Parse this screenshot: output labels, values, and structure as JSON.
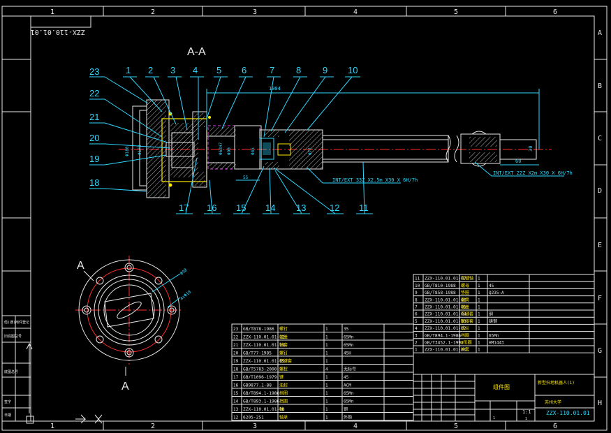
{
  "border": {
    "zones_top": [
      "1",
      "2",
      "3",
      "4",
      "5",
      "6"
    ],
    "zones_bottom": [
      "1",
      "2",
      "3",
      "4",
      "5",
      "6"
    ],
    "zones_right": [
      "A",
      "B",
      "C",
      "D",
      "E",
      "F",
      "G",
      "H"
    ]
  },
  "stamp": "ZZX-110.01.01",
  "section_title": "A-A",
  "view_label": "A",
  "balloons_top": [
    "23",
    "1",
    "2",
    "3",
    "4",
    "5",
    "6",
    "7",
    "8",
    "9",
    "10"
  ],
  "balloons_left": [
    "22",
    "21",
    "20",
    "19",
    "18"
  ],
  "balloons_bottom": [
    "17",
    "16",
    "15",
    "14",
    "13",
    "12",
    "11"
  ],
  "dims": {
    "overall": "1004",
    "d1": "60",
    "d2": "30",
    "d3": "55",
    "thread1": "INT/EXT 33Z X2.5m X30 X 6H/7h",
    "thread2": "INT/EXT 22Z X2m X30 X 6H/7h",
    "dia_a": "Φ180",
    "dia_b": "Φ172",
    "dia_c": "Φ77",
    "dia_d": "Φ45",
    "dia_e": "Φ62H7",
    "dia_f": "Φ90",
    "circle_dim": "Φ98",
    "hole_dim": "4xΦ18"
  },
  "left_strip": [
    "借(通)用件登记",
    "旧底图总号",
    "底图总号",
    "签字",
    "日期"
  ],
  "bom_right": [
    {
      "no": "11",
      "code": "ZZX-110.01.01-07",
      "name": "花键轴",
      "qty": "1",
      "mat": "",
      "note": ""
    },
    {
      "no": "10",
      "code": "GB/T810-1988",
      "name": "螺母",
      "qty": "1",
      "mat": "45",
      "note": ""
    },
    {
      "no": "9",
      "code": "GB/T858-1988",
      "name": "垫圈",
      "qty": "1",
      "mat": "Q235-A",
      "note": ""
    },
    {
      "no": "8",
      "code": "ZZX-110.01.01-06",
      "name": "套筒",
      "qty": "1",
      "mat": "",
      "note": ""
    },
    {
      "no": "7",
      "code": "ZZX-110.01.01-05",
      "name": "端盖",
      "qty": "1",
      "mat": "",
      "note": ""
    },
    {
      "no": "6",
      "code": "ZZX-110.01.01-04",
      "name": "花键套",
      "qty": "1",
      "mat": "钢",
      "note": ""
    },
    {
      "no": "5",
      "code": "ZZX-110.01.01-03",
      "name": "联接套",
      "qty": "1",
      "mat": "铸钢",
      "note": ""
    },
    {
      "no": "4",
      "code": "ZZX-110.01.01-02",
      "name": "法兰",
      "qty": "1",
      "mat": "",
      "note": ""
    },
    {
      "no": "3",
      "code": "GB/T894.1-1986",
      "name": "挡圈",
      "qty": "1",
      "mat": "65Mn",
      "note": ""
    },
    {
      "no": "2",
      "code": "GB/T3452.1-1992",
      "name": "O形圈",
      "qty": "1",
      "mat": "HM1443",
      "note": ""
    },
    {
      "no": "1",
      "code": "ZZX-110.01.01-01",
      "name": "外套",
      "qty": "1",
      "mat": "",
      "note": ""
    }
  ],
  "bom_left": [
    {
      "no": "23",
      "code": "GB/T878-1986",
      "name": "螺钉",
      "qty": "1",
      "mat": "35",
      "note": ""
    },
    {
      "no": "22",
      "code": "ZZX-110.01.01-12",
      "name": "端盖",
      "qty": "1",
      "mat": "65Mn",
      "note": ""
    },
    {
      "no": "21",
      "code": "ZZX-110.01.01-11",
      "name": "轴套",
      "qty": "1",
      "mat": "65Mn",
      "note": ""
    },
    {
      "no": "20",
      "code": "GB/T77-1985",
      "name": "螺钉",
      "qty": "1",
      "mat": "45H",
      "note": ""
    },
    {
      "no": "19",
      "code": "ZZX-110.01.01-09",
      "name": "花键套",
      "qty": "1",
      "mat": "",
      "note": ""
    },
    {
      "no": "18",
      "code": "GB/T5783-2000",
      "name": "螺栓",
      "qty": "4",
      "mat": "无标号",
      "note": ""
    },
    {
      "no": "17",
      "code": "GB/T1096-1979",
      "name": "键",
      "qty": "1",
      "mat": "45",
      "note": ""
    },
    {
      "no": "16",
      "code": "GB9877.1-88",
      "name": "油封",
      "qty": "1",
      "mat": "ACM",
      "note": ""
    },
    {
      "no": "15",
      "code": "GB/T894.1-1986",
      "name": "挡圈",
      "qty": "1",
      "mat": "65Mn",
      "note": ""
    },
    {
      "no": "14",
      "code": "GB/T893.1-1986",
      "name": "挡圈",
      "qty": "1",
      "mat": "65Mn",
      "note": ""
    },
    {
      "no": "13",
      "code": "ZZX-110.01.01-08",
      "name": "轴",
      "qty": "1",
      "mat": "钢",
      "note": ""
    },
    {
      "no": "12",
      "code": "6205-2S1",
      "name": "轴承",
      "qty": "1",
      "mat": "外购",
      "note": ""
    }
  ],
  "title_block": {
    "type": "组件图",
    "name": "新型扫地机器人(1)",
    "school": "苏州大学",
    "drawing_no": "ZZX-110.01.01",
    "scale": "1:1",
    "sheet": "1",
    "page": "1"
  }
}
